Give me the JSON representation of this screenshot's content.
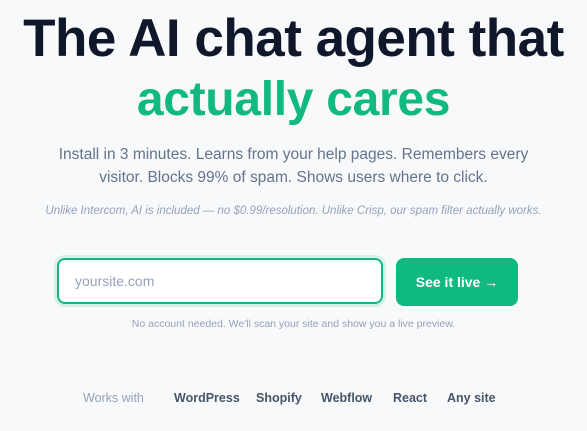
{
  "hero": {
    "headline_line1": "The AI chat agent that",
    "headline_line2": "actually cares",
    "subtitle": "Install in 3 minutes. Learns from your help pages. Remembers every visitor. Blocks 99% of spam. Shows users where to click.",
    "comparison": "Unlike Intercom, AI is included — no $0.99/resolution. Unlike Crisp, our spam filter actually works."
  },
  "signup": {
    "input_placeholder": "yoursite.com",
    "input_value": "",
    "button_label": "See it live →",
    "note": "No account needed. We'll scan your site and show you a live preview."
  },
  "works_with": {
    "label": "Works with",
    "platforms": [
      "WordPress",
      "Shopify",
      "Webflow",
      "React",
      "Any site"
    ]
  },
  "colors": {
    "accent": "#10b981",
    "heading": "#0f172a",
    "muted": "#64748b"
  }
}
